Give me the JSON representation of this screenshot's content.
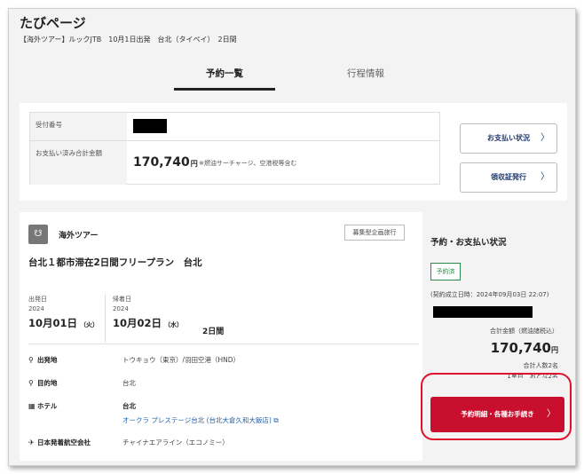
{
  "header": {
    "title": "たびページ",
    "subtitle": "【海外ツアー】ルックJTB　10月1日出発　台北（タイペイ）　2日間"
  },
  "tabs": [
    {
      "label": "予約一覧",
      "active": true
    },
    {
      "label": "行程情報",
      "active": false
    }
  ],
  "summary": {
    "reception_label": "受付番号",
    "paid_label": "お支払い済み合計金額",
    "paid_amount": "170,740",
    "yen": "円",
    "paid_note": "※燃油サーチャージ、空港税等含む"
  },
  "actions": {
    "payment_status": "お支払い状況",
    "receipt": "領収証発行",
    "chevron": "〉"
  },
  "tour": {
    "icon": "☋",
    "type": "海外ツアー",
    "badge": "募集型企画旅行",
    "plan_title": "台北１都市滞在2日間フリープラン　台北",
    "departure": {
      "label": "出発日",
      "year": "2024",
      "date": "10月01日",
      "dow": "（火）"
    },
    "return": {
      "label": "帰着日",
      "year": "2024",
      "date": "10月02日",
      "dow": "（水）"
    },
    "days": "2日間",
    "details": [
      {
        "icon": "⚲",
        "label": "出発地",
        "value": "トウキョウ（東京）/羽田空港（HND）"
      },
      {
        "icon": "⚲",
        "label": "目的地",
        "value": "台北"
      },
      {
        "icon": "▦",
        "label": "ホテル",
        "value": "台北"
      },
      {
        "icon": "✈",
        "label": "日本発着航空会社",
        "value": "チャイナエアライン（エコノミー）"
      }
    ],
    "hotel_link": "オークラ プレステージ台北 (台北大倉久和大飯店)",
    "hotel_link_icon": "⧉"
  },
  "status_panel": {
    "title": "予約・お支払い状況",
    "status": "予約済",
    "contract_date": "(契約成立日時：2024年09月03日 22:07)",
    "total_label": "合計金額（燃油諸税込）",
    "total_amount": "170,740",
    "yen": "円",
    "people_total": "合計人数2名",
    "people_detail": "1室目　おとな2名",
    "action_button": "予約明細・各種お手続き",
    "chevron": "〉"
  },
  "colors": {
    "accent_red": "#c8102e",
    "link_blue": "#1f5fa8",
    "status_green": "#2a8a4a"
  }
}
